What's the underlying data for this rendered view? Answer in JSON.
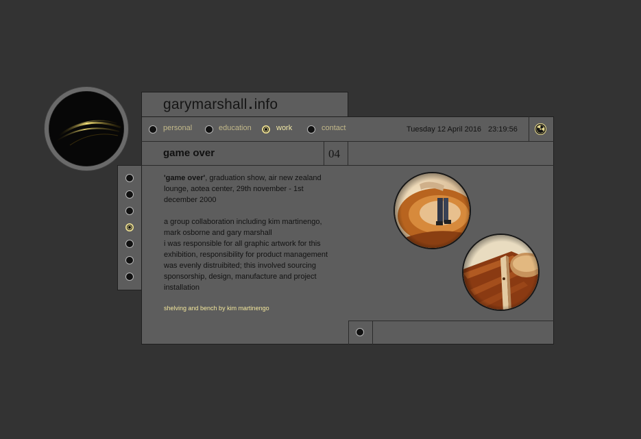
{
  "site": {
    "name_part1": "garymarshall",
    "name_dot": ".",
    "name_part2": "info"
  },
  "nav": {
    "items": [
      {
        "label": "personal",
        "active": false
      },
      {
        "label": "education",
        "active": false
      },
      {
        "label": "work",
        "active": true
      },
      {
        "label": "contact",
        "active": false
      }
    ]
  },
  "header": {
    "date": "Tuesday 12 April 2016",
    "time": "23:19:56"
  },
  "page": {
    "heading": "game over",
    "number": "04",
    "intro_bold": "'game over'",
    "intro_rest": ", graduation show, air new zealand lounge, aotea center, 29th november - 1st december 2000",
    "description": "a group collaboration including kim martinengo, mark osborne and gary marshall",
    "responsibility": "i was responsible for all graphic artwork for this exhibition, responsibility for product management was evenly distruibited; this involved sourcing sponsorship, design, manufacture and project installation",
    "credit": "shelving and bench by kim martinengo"
  },
  "side_menu": {
    "count": 7,
    "active_index": 3
  },
  "colors": {
    "background": "#333333",
    "panel": "#5d5d5d",
    "accent": "#e6d98e",
    "nav_text": "#c3b98a"
  },
  "icons": {
    "logo": "swoosh-logo-icon",
    "corner": "radiation-icon",
    "photos": [
      "shelving-photo",
      "bench-photo"
    ]
  }
}
